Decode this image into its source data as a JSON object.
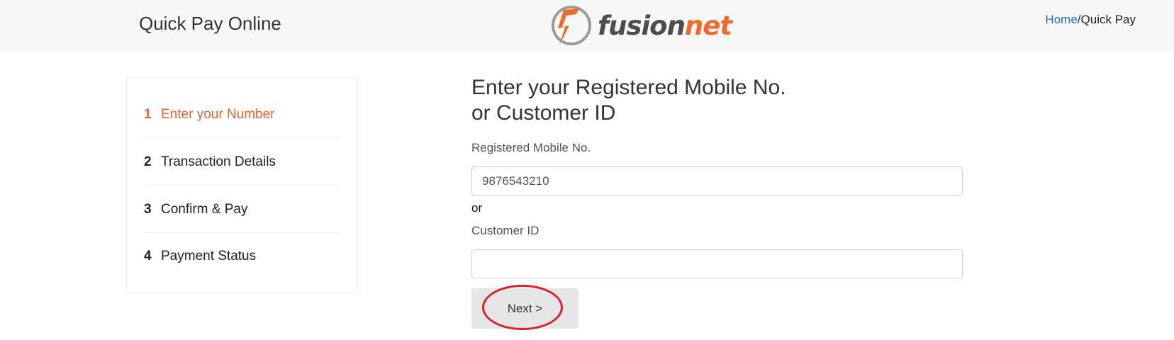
{
  "header": {
    "title": "Quick Pay Online",
    "logo": {
      "text_part1": "fusion",
      "text_part2": "net",
      "icon": "fusionnet-logo-icon",
      "colors": {
        "orange": "#ee6a2e",
        "gray": "#4d4d4d"
      }
    },
    "breadcrumb": {
      "home": "Home",
      "separator": "/",
      "current": "Quick Pay"
    }
  },
  "steps": [
    {
      "number": "1",
      "label": "Enter your Number",
      "active": true
    },
    {
      "number": "2",
      "label": "Transaction Details",
      "active": false
    },
    {
      "number": "3",
      "label": "Confirm & Pay",
      "active": false
    },
    {
      "number": "4",
      "label": "Payment Status",
      "active": false
    }
  ],
  "form": {
    "title_line1": "Enter your Registered Mobile No.",
    "title_line2": "or Customer ID",
    "mobile_label": "Registered Mobile No.",
    "mobile_value": "9876543210",
    "or_text": "or",
    "customer_label": "Customer ID",
    "customer_value": "",
    "next_label": "Next >"
  },
  "colors": {
    "accent": "#e2632f",
    "link": "#2a6eb0",
    "highlight_circle": "#d8232a"
  }
}
